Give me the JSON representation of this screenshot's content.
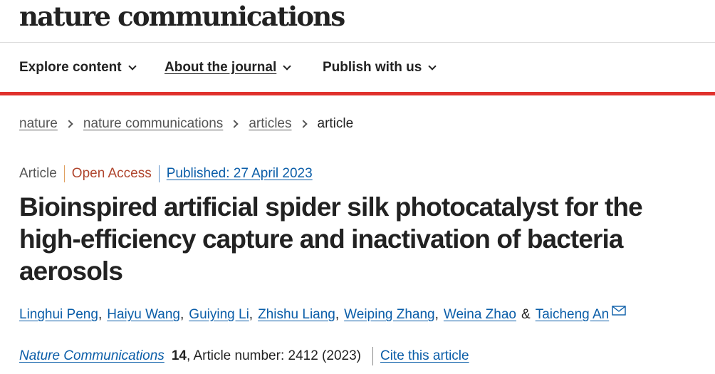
{
  "site": {
    "logo": "nature communications"
  },
  "nav": {
    "items": [
      {
        "label": "Explore content"
      },
      {
        "label": "About the journal"
      },
      {
        "label": "Publish with us"
      }
    ],
    "accent_color": "#e0322d"
  },
  "breadcrumb": {
    "items": [
      "nature",
      "nature communications",
      "articles",
      "article"
    ]
  },
  "article": {
    "type": "Article",
    "access": "Open Access",
    "published": "Published: 27 April 2023",
    "title": "Bioinspired artificial spider silk photocatalyst for the high-efficiency capture and inactivation of bacteria aerosols",
    "authors": [
      "Linghui Peng",
      "Haiyu Wang",
      "Guiying Li",
      "Zhishu Liang",
      "Weiping Zhang",
      "Weina Zhao",
      "Taicheng An"
    ],
    "author_separator": ",",
    "author_last_joiner": "&",
    "corresponding_icon": "mail-icon",
    "citation": {
      "journal": "Nature Communications",
      "volume": "14",
      "details": ", Article number: 2412 (2023)",
      "cite_label": "Cite this article"
    }
  },
  "colors": {
    "link": "#0a5da8",
    "open_access": "#b0462e",
    "text": "#222222",
    "muted": "#555555"
  }
}
